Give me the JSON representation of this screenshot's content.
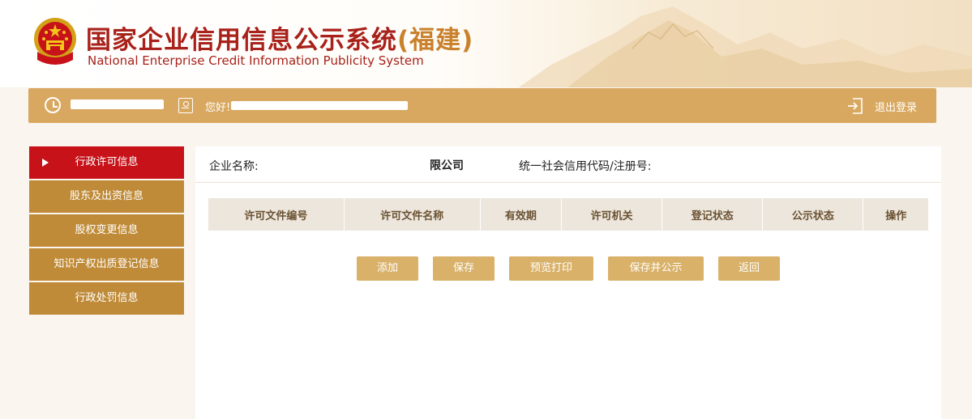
{
  "header": {
    "title_cn": "国家企业信用信息公示系统",
    "title_region": "(福建)",
    "title_en": "National Enterprise Credit Information Publicity System"
  },
  "userbar": {
    "greeting": "您好!",
    "logout_label": "退出登录",
    "icons": [
      "clock-icon",
      "id-card-icon",
      "logout-icon"
    ]
  },
  "sidebar": {
    "items": [
      {
        "label": "行政许可信息",
        "active": true
      },
      {
        "label": "股东及出资信息",
        "active": false
      },
      {
        "label": "股权变更信息",
        "active": false
      },
      {
        "label": "知识产权出质登记信息",
        "active": false
      },
      {
        "label": "行政处罚信息",
        "active": false
      }
    ]
  },
  "info": {
    "company_label": "企业名称:",
    "company_value": "限公司",
    "credit_label": "统一社会信用代码/注册号:"
  },
  "table": {
    "columns": [
      "许可文件编号",
      "许可文件名称",
      "有效期",
      "许可机关",
      "登记状态",
      "公示状态",
      "操作"
    ]
  },
  "buttons": {
    "add": "添加",
    "save": "保存",
    "preview": "预览打印",
    "save_publish": "保存并公示",
    "back": "返回"
  },
  "colors": {
    "brand_red": "#a8211a",
    "accent_gold": "#d9a860",
    "sidebar_brown": "#c08b38",
    "active_red": "#c8121a",
    "button_gold": "#d9b169"
  }
}
